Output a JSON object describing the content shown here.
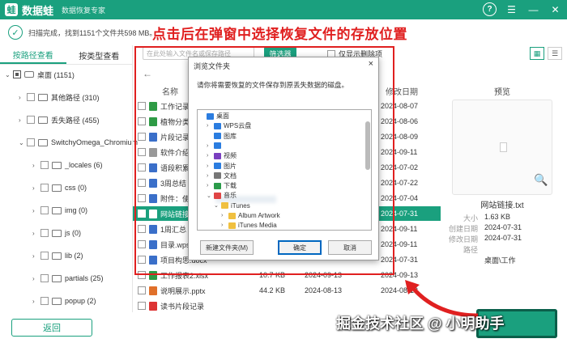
{
  "app": {
    "name": "数据蛙",
    "subtitle": "数据恢复专家",
    "logo_letter": "蛙"
  },
  "titlebar_icons": [
    "help-icon",
    "menu-icon",
    "minimize-icon",
    "close-icon"
  ],
  "status": {
    "scan_text": "扫描完成，找到1151个文件共598 MB。"
  },
  "annotation": "点击后在弹窗中选择恢复文件的存放位置",
  "left_tabs": [
    "按路径查看",
    "按类型查看"
  ],
  "tree": [
    {
      "label": "桌面 (1151)",
      "level": 0,
      "expanded": true
    },
    {
      "label": "其他路径 (310)",
      "level": 1
    },
    {
      "label": "丢失路径 (455)",
      "level": 1
    },
    {
      "label": "SwitchyOmega_Chromium",
      "level": 1,
      "expanded": true
    },
    {
      "label": "_locales (6)",
      "level": 2
    },
    {
      "label": "css (0)",
      "level": 2
    },
    {
      "label": "img (0)",
      "level": 2
    },
    {
      "label": "js (0)",
      "level": 2
    },
    {
      "label": "lib (2)",
      "level": 2
    },
    {
      "label": "partials (25)",
      "level": 2
    },
    {
      "label": "popup (2)",
      "level": 2
    }
  ],
  "back_label": "返回",
  "toolbar": {
    "search_placeholder": "在此处输入文件名或保存路径",
    "filter_label": "筛选器",
    "only_deleted_label": "仅显示删除项"
  },
  "columns": {
    "name": "名称",
    "modified": "修改日期"
  },
  "files": [
    {
      "name": "工作记录表",
      "size": "",
      "date1": "",
      "date2": "2024-08-07",
      "color": "#2e9b45"
    },
    {
      "name": "植物分类",
      "size": "",
      "date1": "",
      "date2": "2024-08-06",
      "color": "#2e9b45"
    },
    {
      "name": "片段记录",
      "size": "",
      "date1": "",
      "date2": "2024-08-09",
      "color": "#3a6fc9"
    },
    {
      "name": "软件介绍",
      "size": "",
      "date1": "",
      "date2": "2024-09-11",
      "color": "#999999"
    },
    {
      "name": "语段积累",
      "size": "",
      "date1": "",
      "date2": "2024-07-02",
      "color": "#3a6fc9"
    },
    {
      "name": "3周总结",
      "size": "",
      "date1": "",
      "date2": "2024-07-22",
      "color": "#3a6fc9"
    },
    {
      "name": "附件：使用注",
      "size": "",
      "date1": "",
      "date2": "2024-07-04",
      "color": "#3a6fc9"
    },
    {
      "name": "网站链接.txt",
      "size": "",
      "date1": "",
      "date2": "2024-07-31",
      "color": "#ffffff",
      "selected": true
    },
    {
      "name": "1周汇总",
      "size": "",
      "date1": "",
      "date2": "2024-09-11",
      "color": "#3a6fc9"
    },
    {
      "name": "目录.wps",
      "size": "",
      "date1": "",
      "date2": "2024-09-11",
      "color": "#3a6fc9"
    },
    {
      "name": "项目构思.docx",
      "size": "",
      "date1": "",
      "date2": "2024-07-31",
      "color": "#3a6fc9"
    },
    {
      "name": "工作报表2.xlsx",
      "size": "10.7 KB",
      "date1": "2024-09-13",
      "date2": "2024-09-13",
      "color": "#2e9b45"
    },
    {
      "name": "说明展示.pptx",
      "size": "44.2 KB",
      "date1": "2024-08-13",
      "date2": "2024-08-13",
      "color": "#e0702a"
    },
    {
      "name": "读书片段记录",
      "size": "",
      "date1": "",
      "date2": "",
      "color": "#d33"
    }
  ],
  "preview": {
    "title": "预览",
    "filename": "网站链接.txt",
    "meta": [
      {
        "k": "大小",
        "v": "1.63 KB"
      },
      {
        "k": "创建日期",
        "v": "2024-07-31"
      },
      {
        "k": "修改日期",
        "v": "2024-07-31"
      },
      {
        "k": "路径",
        "v": ""
      },
      {
        "k": "",
        "v": "桌面\\工作"
      }
    ]
  },
  "dialog": {
    "title": "浏览文件夹",
    "close": "×",
    "message": "请你将需要恢复的文件保存到原丢失数据的磁盘。",
    "nodes": [
      {
        "label": "桌面",
        "arrow": "",
        "color": "#2b7de0"
      },
      {
        "label": "WPS云盘",
        "arrow": "›",
        "color": "#2b7de0"
      },
      {
        "label": "图库",
        "arrow": "",
        "color": "#2b7de0"
      },
      {
        "label": "",
        "arrow": "›",
        "color": "#2b7de0"
      },
      {
        "label": "视频",
        "arrow": "›",
        "color": "#7a3fc0"
      },
      {
        "label": "图片",
        "arrow": "›",
        "color": "#2b7de0"
      },
      {
        "label": "文档",
        "arrow": "›",
        "color": "#777777"
      },
      {
        "label": "下载",
        "arrow": "›",
        "color": "#2b9b4a"
      },
      {
        "label": "音乐",
        "arrow": "⌄",
        "color": "#e04545"
      },
      {
        "label": "iTunes",
        "arrow": "⌄",
        "color": "#f0c040"
      },
      {
        "label": "Album Artwork",
        "arrow": "›",
        "color": "#f0c040"
      },
      {
        "label": "iTunes Media",
        "arrow": "›",
        "color": "#f0c040"
      }
    ],
    "new_folder": "新建文件夹(M)",
    "ok": "确定",
    "cancel": "取消"
  },
  "watermark": "掘金技术社区 @ 小明助手"
}
